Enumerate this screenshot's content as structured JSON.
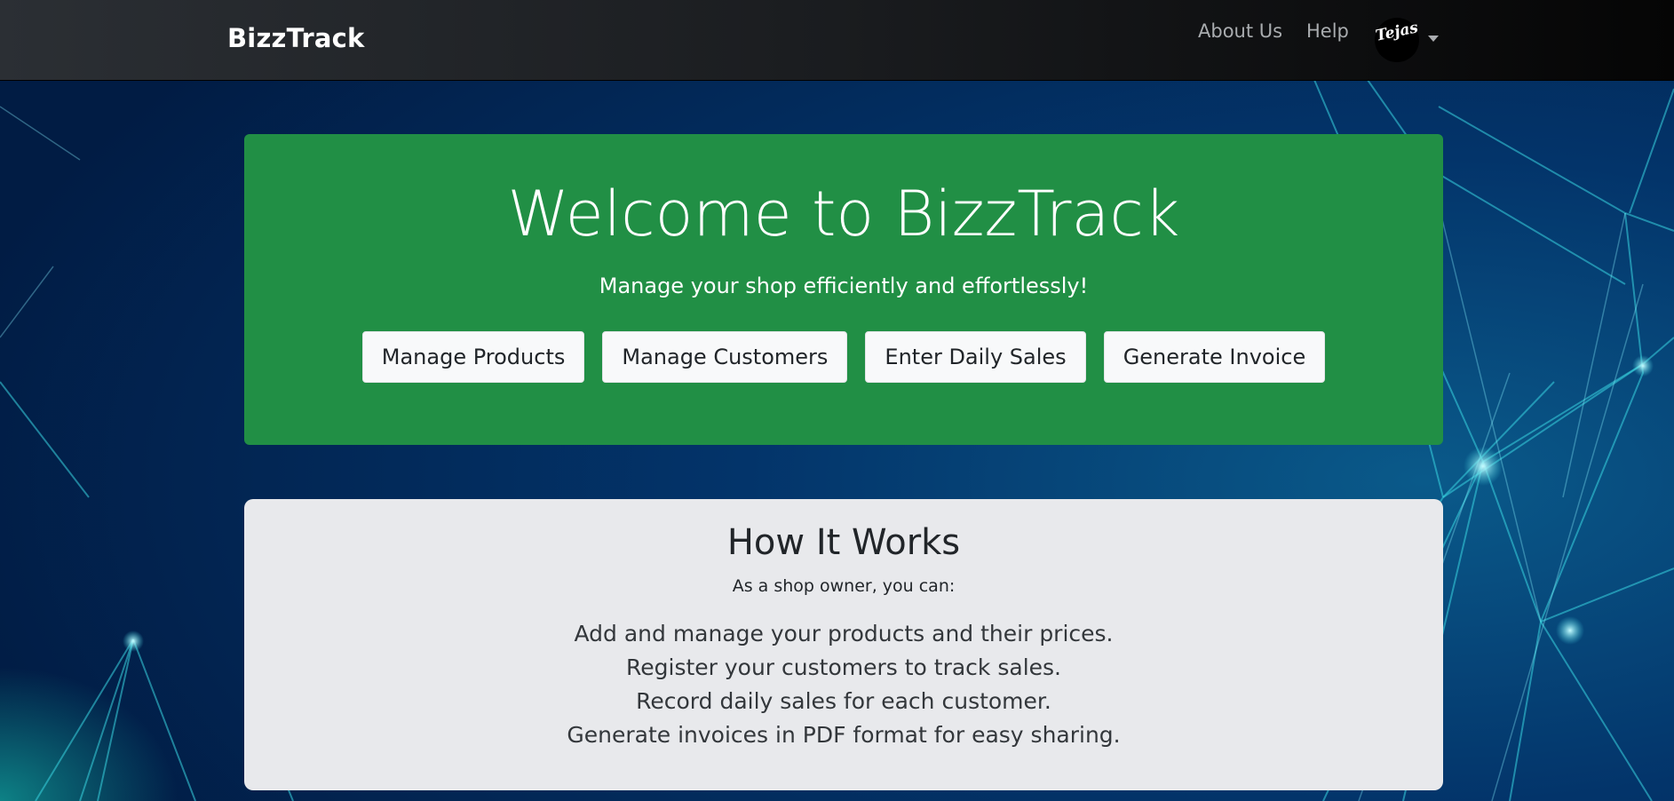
{
  "navbar": {
    "brand": "BizzTrack",
    "links": {
      "about": "About Us",
      "help": "Help"
    },
    "user": {
      "avatar_text": "Tejas"
    }
  },
  "hero": {
    "title": "Welcome to BizzTrack",
    "subtitle": "Manage your shop efficiently and effortlessly!",
    "buttons": [
      "Manage Products",
      "Manage Customers",
      "Enter Daily Sales",
      "Generate Invoice"
    ]
  },
  "how_it_works": {
    "title": "How It Works",
    "subtitle": "As a shop owner, you can:",
    "items": [
      "Add and manage your products and their prices.",
      "Register your customers to track sales.",
      "Record daily sales for each customer.",
      "Generate invoices in PDF format for easy sharing."
    ]
  },
  "colors": {
    "hero_green": "#218f45",
    "background_navy": "#012a4e",
    "card_gray": "#e8e9ec",
    "network_cyan": "#39d3e0"
  },
  "icons": {
    "user_menu": "chevron-down-icon"
  }
}
